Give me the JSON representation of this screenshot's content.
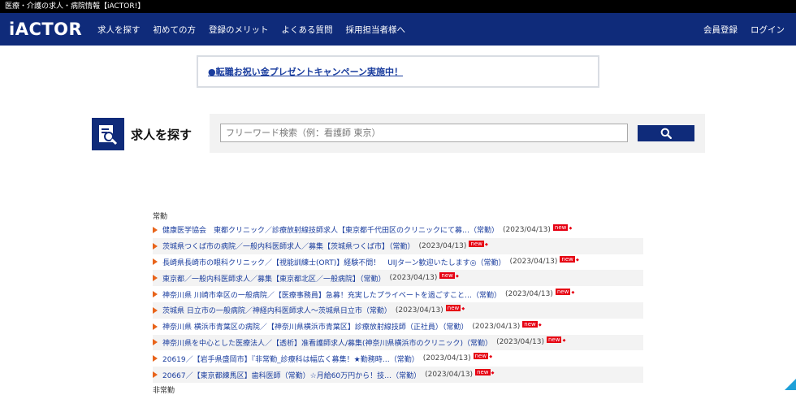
{
  "topbar": {
    "text": "医療・介護の求人・病院情報【iACTOR!】"
  },
  "header": {
    "logo": "iACTOR",
    "nav": [
      "求人を探す",
      "初めての方",
      "登録のメリット",
      "よくある質問",
      "採用担当者様へ"
    ],
    "register": "会員登録",
    "login": "ログイン"
  },
  "campaign": {
    "text": "●転職お祝い金プレゼントキャンペーン実施中！"
  },
  "search": {
    "title": "求人を探す",
    "placeholder": "フリーワード検索（例：看護師 東京）",
    "button_icon": "magnifier-icon"
  },
  "listing": {
    "heading": "常勤",
    "next_heading": "非常勤",
    "badge": "new",
    "jobs": [
      {
        "title": "健康医学協会　東都クリニック／診療放射線技師求人【東京都千代田区のクリニックにて募…（常勤）",
        "date": "(2023/04/13)"
      },
      {
        "title": "茨城県つくば市の病院／一般内科医師求人／募集【茨城県つくば市】（常勤）",
        "date": "(2023/04/13)"
      },
      {
        "title": "長崎県長崎市の眼科クリニック／【視能訓練士(ORT)】経験不問！　UIJターン歓迎いたします◎（常勤）",
        "date": "(2023/04/13)"
      },
      {
        "title": "東京都／一般内科医師求人／募集【東京都北区／一般病院】（常勤）",
        "date": "(2023/04/13)"
      },
      {
        "title": "神奈川県 川崎市幸区の一般病院／【医療事務員】急募！充実したプライベートを過ごすこと…（常勤）",
        "date": "(2023/04/13)"
      },
      {
        "title": "茨城県 日立市の一般病院／神経内科医師求人～茨城県日立市（常勤）",
        "date": "(2023/04/13)"
      },
      {
        "title": "神奈川県 横浜市青葉区の病院／【神奈川県横浜市青葉区】診療放射線技師（正社員）（常勤）",
        "date": "(2023/04/13)"
      },
      {
        "title": "神奈川県を中心とした医療法人／【透析】准看護師求人/募集(神奈川県横浜市のクリニック)（常勤）",
        "date": "(2023/04/13)"
      },
      {
        "title": "20619／【岩手県盛岡市】『非常勤_診療科は幅広く募集！★勤務時…（常勤）",
        "date": "(2023/04/13)"
      },
      {
        "title": "20667／【東京都練馬区】歯科医師（常勤）☆月給60万円から！技…（常勤）",
        "date": "(2023/04/13)"
      }
    ]
  },
  "colors": {
    "navy": "#0f2b7a",
    "link": "#1a3d9e",
    "arrow": "#e8641b",
    "badge": "#e60012"
  }
}
